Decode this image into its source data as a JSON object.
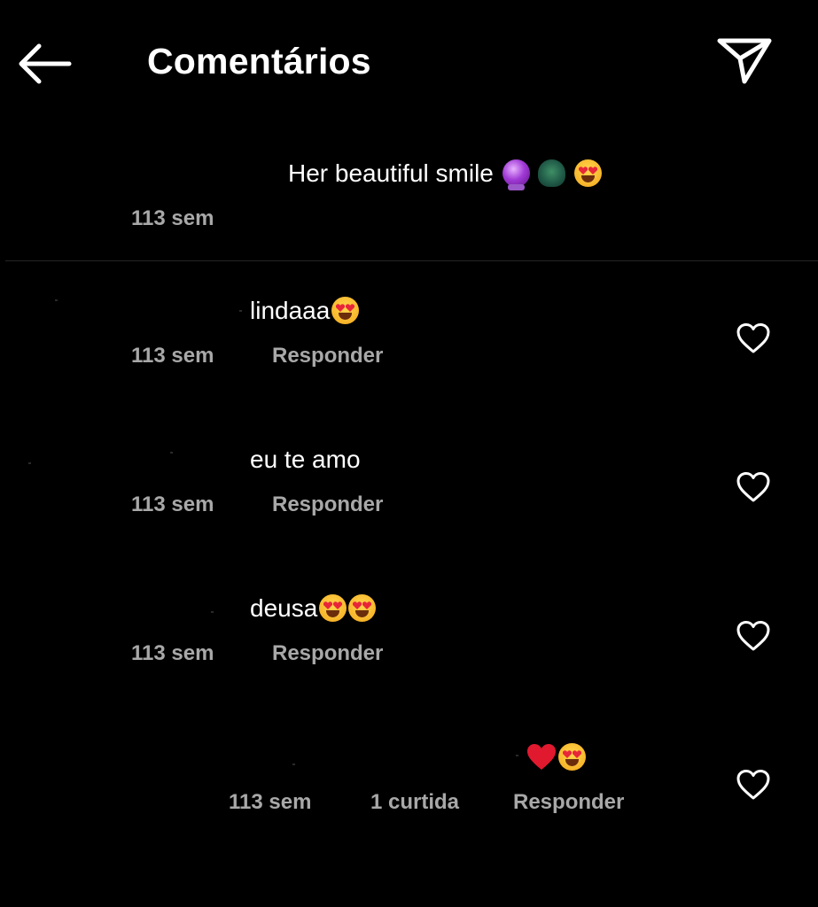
{
  "header": {
    "title": "Comentários",
    "back_icon": "arrow-left-icon",
    "share_icon": "paper-plane-icon"
  },
  "caption": {
    "text": "Her beautiful smile",
    "emojis": [
      "crystal-ball",
      "peacock",
      "heart-eyes"
    ],
    "time": "113 sem"
  },
  "comments": [
    {
      "text": "lindaaa",
      "emojis": [
        "heart-eyes"
      ],
      "time": "113 sem",
      "reply_label": "Responder"
    },
    {
      "text": "eu te amo",
      "emojis": [],
      "time": "113 sem",
      "reply_label": "Responder"
    },
    {
      "text": "deusa",
      "emojis": [
        "heart-eyes",
        "heart-eyes"
      ],
      "time": "113 sem",
      "reply_label": "Responder"
    },
    {
      "text": "",
      "emojis": [
        "red-heart",
        "heart-eyes"
      ],
      "time": "113 sem",
      "likes": "1 curtida",
      "reply_label": "Responder"
    }
  ],
  "colors": {
    "background": "#000000",
    "text": "#ffffff",
    "secondary_text": "#a8a8a8",
    "divider": "#262626"
  }
}
